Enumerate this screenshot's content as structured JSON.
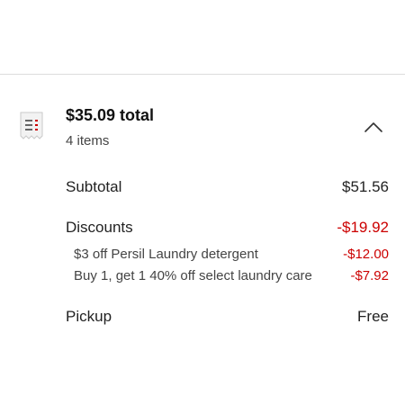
{
  "summary": {
    "total_label": "$35.09 total",
    "items_label": "4 items",
    "icon": "receipt-icon",
    "expand_icon": "chevron-up-icon"
  },
  "lines": {
    "subtotal": {
      "label": "Subtotal",
      "value": "$51.56"
    },
    "discounts": {
      "label": "Discounts",
      "value": "-$19.92",
      "items": [
        {
          "label": "$3 off Persil Laundry detergent",
          "value": "-$12.00"
        },
        {
          "label": "Buy 1, get 1 40% off select laundry care",
          "value": "-$7.92"
        }
      ]
    },
    "pickup": {
      "label": "Pickup",
      "value": "Free"
    }
  },
  "colors": {
    "discount": "#cc0000",
    "text": "#222222",
    "divider": "#dcdcdc"
  }
}
